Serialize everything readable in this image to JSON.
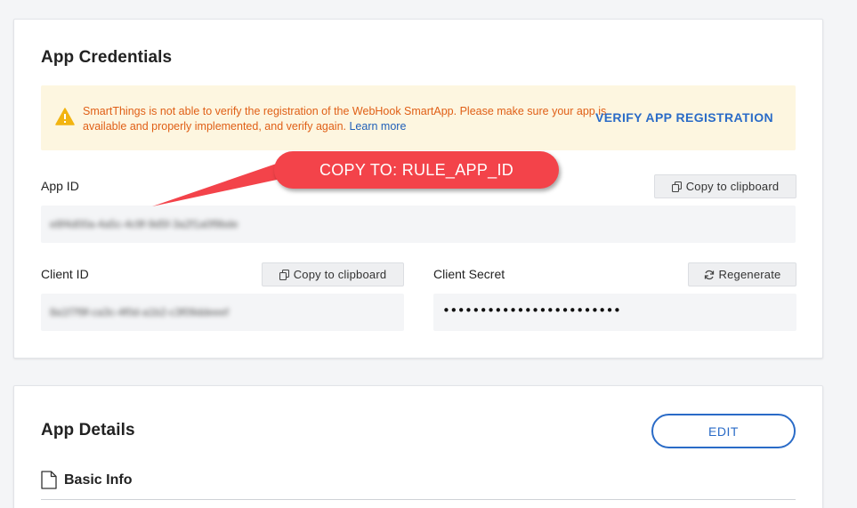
{
  "credentials": {
    "title": "App Credentials",
    "warning": {
      "message": "SmartThings is not able to verify the registration of the WebHook SmartApp. Please make sure your app is available and properly implemented, and verify again. ",
      "learn_more": "Learn more",
      "verify_label": "VERIFY APP REGISTRATION",
      "icon": "warning-triangle-icon"
    },
    "app_id": {
      "label": "App ID",
      "copy_label": "Copy to clipboard",
      "value": "e8f4d00a-4a5c-4c9f-9d5f-3a2f1a0f9bde"
    },
    "client_id": {
      "label": "Client ID",
      "copy_label": "Copy to clipboard",
      "value": "8a1f7f9f-ca3c-4f0d-a1b2-c3f09ddeeef"
    },
    "client_secret": {
      "label": "Client Secret",
      "regenerate_label": "Regenerate",
      "value": "••••••••••••••••••••••••"
    }
  },
  "details": {
    "title": "App Details",
    "edit_label": "EDIT",
    "basic_info_label": "Basic Info"
  },
  "annotation": {
    "text": "COPY TO: RULE_APP_ID"
  },
  "colors": {
    "warning_text": "#e05f16",
    "link": "#1f5fb8",
    "accent": "#2a6bc7",
    "callout": "#f3434a",
    "warning_bg": "#fdf6e0"
  }
}
